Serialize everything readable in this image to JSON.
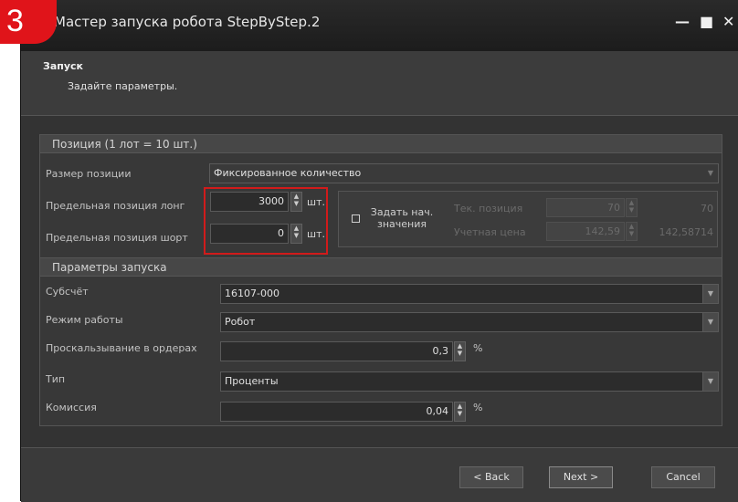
{
  "step_badge": "3",
  "window": {
    "title": "Мастер запуска робота StepByStep.2",
    "controls": {
      "minimize": "—",
      "maximize": "■",
      "close": "✕"
    }
  },
  "header": {
    "title": "Запуск",
    "subtitle": "Задайте параметры."
  },
  "position_group": {
    "title": "Позиция (1 лот = 10 шт.)",
    "size_label": "Размер позиции",
    "size_value": "Фиксированное количество",
    "long_label": "Предельная позиция лонг",
    "long_value": "3000",
    "long_unit": "шт.",
    "short_label": "Предельная позиция шорт",
    "short_value": "0",
    "short_unit": "шт.",
    "init_checkbox_label": "Задать нач. значения",
    "init_checked": false,
    "current_pos_label": "Тек. позиция",
    "current_pos_value": "70",
    "current_pos_readout": "70",
    "account_price_label": "Учетная цена",
    "account_price_value": "142,59",
    "account_price_readout": "142,58714"
  },
  "launch_group": {
    "title": "Параметры запуска",
    "subaccount_label": "Субсчёт",
    "subaccount_value": "16107-000",
    "mode_label": "Режим работы",
    "mode_value": "Робот",
    "slippage_label": "Проскальзывание в ордерах",
    "slippage_value": "0,3",
    "slippage_unit": "%",
    "type_label": "Тип",
    "type_value": "Проценты",
    "commission_label": "Комиссия",
    "commission_value": "0,04",
    "commission_unit": "%"
  },
  "buttons": {
    "back": "< Back",
    "next": "Next >",
    "cancel": "Cancel"
  },
  "colors": {
    "highlight": "#d11b1b",
    "badge": "#e0141a"
  }
}
